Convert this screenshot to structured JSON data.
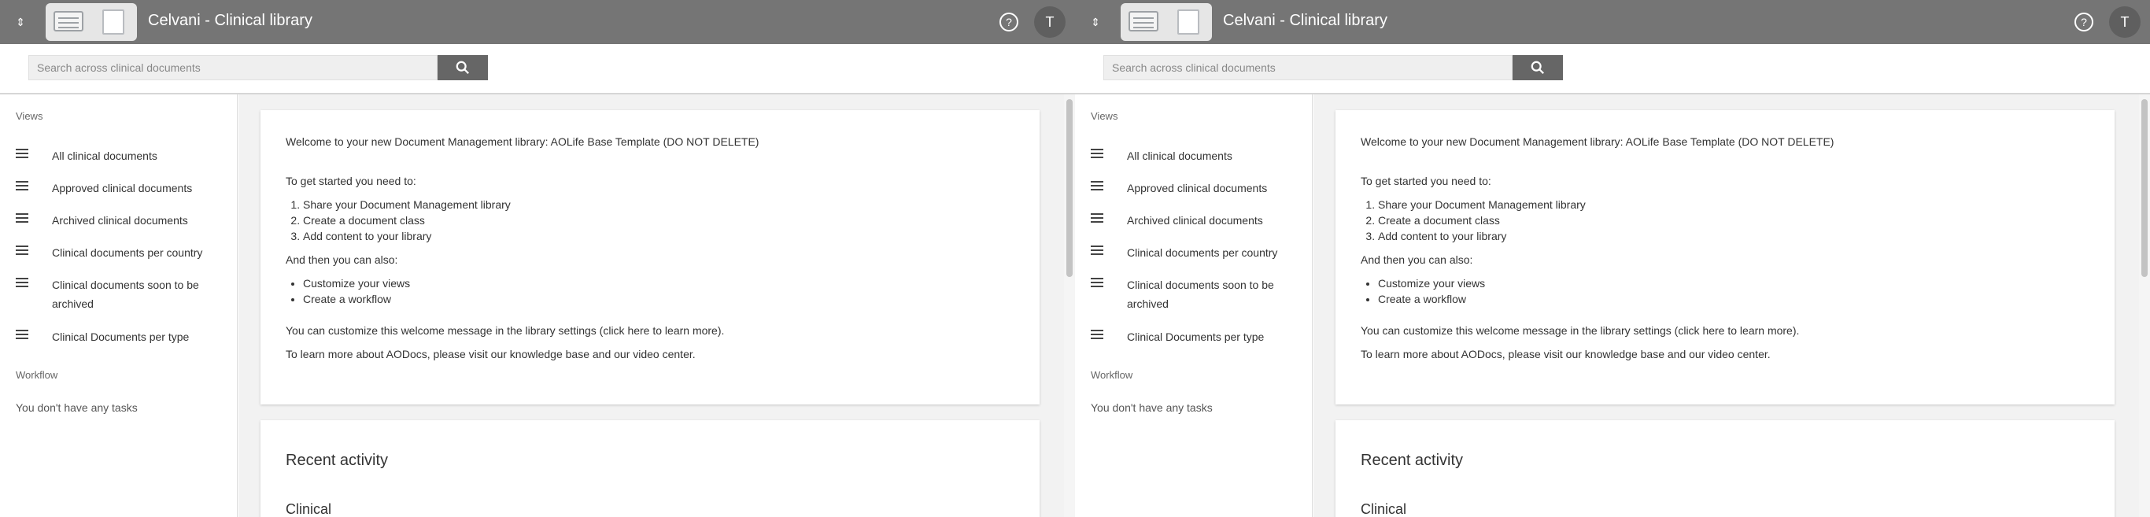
{
  "app": {
    "title": "Celvani - Clinical library",
    "menu_icon": "menu-toggle-icon",
    "help_icon": "help-icon",
    "avatar_initial": "T"
  },
  "search": {
    "placeholder": "Search across clinical documents",
    "button_icon": "search-icon"
  },
  "sidebar": {
    "views_label": "Views",
    "items": [
      {
        "label": "All clinical documents",
        "icon": "list-icon"
      },
      {
        "label": "Approved clinical documents",
        "icon": "list-icon"
      },
      {
        "label": "Archived clinical documents",
        "icon": "list-icon"
      },
      {
        "label": "Clinical documents per country",
        "icon": "list-icon"
      },
      {
        "label": "Clinical documents soon to be archived",
        "icon": "list-icon"
      },
      {
        "label": "Clinical Documents per type",
        "icon": "list-icon"
      }
    ],
    "workflow_label": "Workflow",
    "tasks_text": "You don't have any tasks"
  },
  "welcome": {
    "intro": "Welcome to your new Document Management library: AOLife Base Template (DO NOT DELETE)",
    "get_started": "To get started you need to:",
    "steps": [
      "Share your Document Management library",
      "Create a document class",
      "Add content to your library"
    ],
    "and_then": "And then you can also:",
    "extras": [
      "Customize your views",
      "Create a workflow"
    ],
    "customize": "You can customize this welcome message in the library settings (click here to learn more).",
    "learn_more": "To learn more about AODocs, please visit our knowledge base and our video center."
  },
  "recent": {
    "title": "Recent activity",
    "subtitle": "Clinical"
  },
  "colors": {
    "topbar": "#757575",
    "search_button": "#666666",
    "background": "#f2f2f2"
  }
}
